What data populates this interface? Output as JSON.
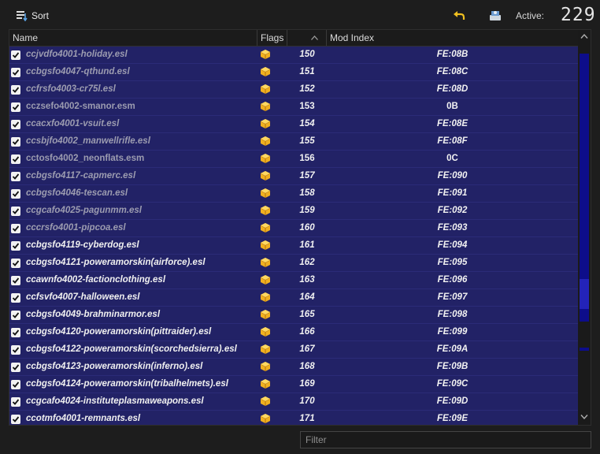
{
  "toolbar": {
    "sort_label": "Sort",
    "active_label": "Active:",
    "active_count": "229"
  },
  "columns": {
    "name": "Name",
    "flags": "Flags",
    "priority": "",
    "mod_index": "Mod Index"
  },
  "colors": {
    "row_bg": "#222266",
    "scroll_track": "#0d0d8a",
    "flag_icon": "#f0b020"
  },
  "mods": [
    {
      "name": "ccjvdfo4001-holiday.esl",
      "priority": "150",
      "mod_index": "FE:08B",
      "checked": true,
      "tone": "grey",
      "italic": true
    },
    {
      "name": "ccbgsfo4047-qthund.esl",
      "priority": "151",
      "mod_index": "FE:08C",
      "checked": true,
      "tone": "grey",
      "italic": true
    },
    {
      "name": "ccfrsfo4003-cr75l.esl",
      "priority": "152",
      "mod_index": "FE:08D",
      "checked": true,
      "tone": "grey",
      "italic": true
    },
    {
      "name": "cczsefo4002-smanor.esm",
      "priority": "153",
      "mod_index": "0B",
      "checked": true,
      "tone": "grey",
      "italic": false
    },
    {
      "name": "ccacxfo4001-vsuit.esl",
      "priority": "154",
      "mod_index": "FE:08E",
      "checked": true,
      "tone": "grey",
      "italic": true
    },
    {
      "name": "ccsbjfo4002_manwellrifle.esl",
      "priority": "155",
      "mod_index": "FE:08F",
      "checked": true,
      "tone": "grey",
      "italic": true
    },
    {
      "name": "cctosfo4002_neonflats.esm",
      "priority": "156",
      "mod_index": "0C",
      "checked": true,
      "tone": "grey",
      "italic": false
    },
    {
      "name": "ccbgsfo4117-capmerc.esl",
      "priority": "157",
      "mod_index": "FE:090",
      "checked": true,
      "tone": "grey",
      "italic": true
    },
    {
      "name": "ccbgsfo4046-tescan.esl",
      "priority": "158",
      "mod_index": "FE:091",
      "checked": true,
      "tone": "grey",
      "italic": true
    },
    {
      "name": "ccgcafo4025-pagunmm.esl",
      "priority": "159",
      "mod_index": "FE:092",
      "checked": true,
      "tone": "grey",
      "italic": true
    },
    {
      "name": "cccrsfo4001-pipcoa.esl",
      "priority": "160",
      "mod_index": "FE:093",
      "checked": true,
      "tone": "grey",
      "italic": true
    },
    {
      "name": "ccbgsfo4119-cyberdog.esl",
      "priority": "161",
      "mod_index": "FE:094",
      "checked": true,
      "tone": "white",
      "italic": true
    },
    {
      "name": "ccbgsfo4121-poweramorskin(airforce).esl",
      "priority": "162",
      "mod_index": "FE:095",
      "checked": true,
      "tone": "white",
      "italic": true
    },
    {
      "name": "ccawnfo4002-factionclothing.esl",
      "priority": "163",
      "mod_index": "FE:096",
      "checked": true,
      "tone": "white",
      "italic": true
    },
    {
      "name": "ccfsvfo4007-halloween.esl",
      "priority": "164",
      "mod_index": "FE:097",
      "checked": true,
      "tone": "white",
      "italic": true
    },
    {
      "name": "ccbgsfo4049-brahminarmor.esl",
      "priority": "165",
      "mod_index": "FE:098",
      "checked": true,
      "tone": "white",
      "italic": true
    },
    {
      "name": "ccbgsfo4120-poweramorskin(pittraider).esl",
      "priority": "166",
      "mod_index": "FE:099",
      "checked": true,
      "tone": "white",
      "italic": true
    },
    {
      "name": "ccbgsfo4122-poweramorskin(scorchedsierra).esl",
      "priority": "167",
      "mod_index": "FE:09A",
      "checked": true,
      "tone": "white",
      "italic": true
    },
    {
      "name": "ccbgsfo4123-poweramorskin(inferno).esl",
      "priority": "168",
      "mod_index": "FE:09B",
      "checked": true,
      "tone": "white",
      "italic": true
    },
    {
      "name": "ccbgsfo4124-poweramorskin(tribalhelmets).esl",
      "priority": "169",
      "mod_index": "FE:09C",
      "checked": true,
      "tone": "white",
      "italic": true
    },
    {
      "name": "ccgcafo4024-instituteplasmaweapons.esl",
      "priority": "170",
      "mod_index": "FE:09D",
      "checked": true,
      "tone": "white",
      "italic": true
    },
    {
      "name": "ccotmfo4001-remnants.esl",
      "priority": "171",
      "mod_index": "FE:09E",
      "checked": true,
      "tone": "white",
      "italic": true
    }
  ],
  "filter": {
    "placeholder": "Filter",
    "value": ""
  }
}
